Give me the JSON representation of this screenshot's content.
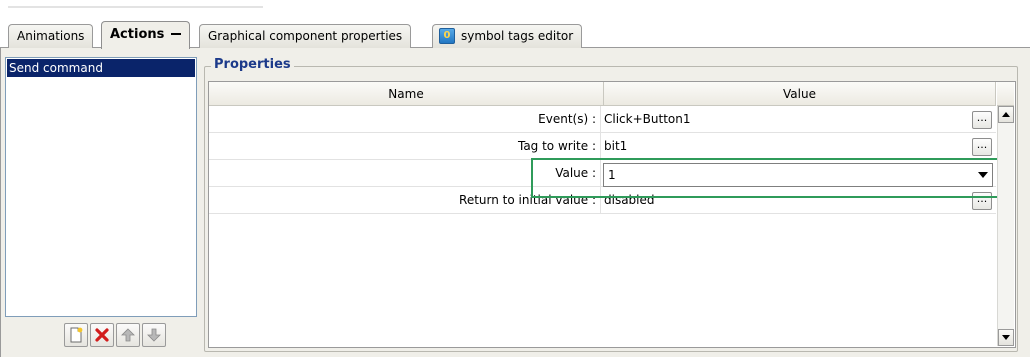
{
  "tabs": [
    {
      "label": "Animations",
      "active": false
    },
    {
      "label": "Actions",
      "active": true
    },
    {
      "label": "Graphical component properties",
      "active": false
    },
    {
      "label": "symbol tags editor",
      "active": false,
      "icon": "tag-editor-icon"
    }
  ],
  "actions": {
    "items": [
      "Send command"
    ],
    "selected": "Send command",
    "toolbar": [
      "add-action-icon",
      "delete-action-icon",
      "move-up-icon",
      "move-down-icon"
    ]
  },
  "properties": {
    "title": "Properties",
    "columns": {
      "name": "Name",
      "value": "Value"
    },
    "rows": [
      {
        "name": "Event(s) :",
        "value": "Click+Button1",
        "editor": "ellipsis"
      },
      {
        "name": "Tag to write :",
        "value": "bit1",
        "editor": "ellipsis"
      },
      {
        "name": "Value :",
        "value": "1",
        "editor": "dropdown"
      },
      {
        "name": "Return to initial value :",
        "value": "disabled",
        "editor": "ellipsis"
      }
    ],
    "ellipsis_label": "..."
  },
  "colors": {
    "selection": "#0a246a",
    "highlight": "#2f9b5a",
    "group_title": "#1c3a8a",
    "panel": "#f0efe9"
  }
}
